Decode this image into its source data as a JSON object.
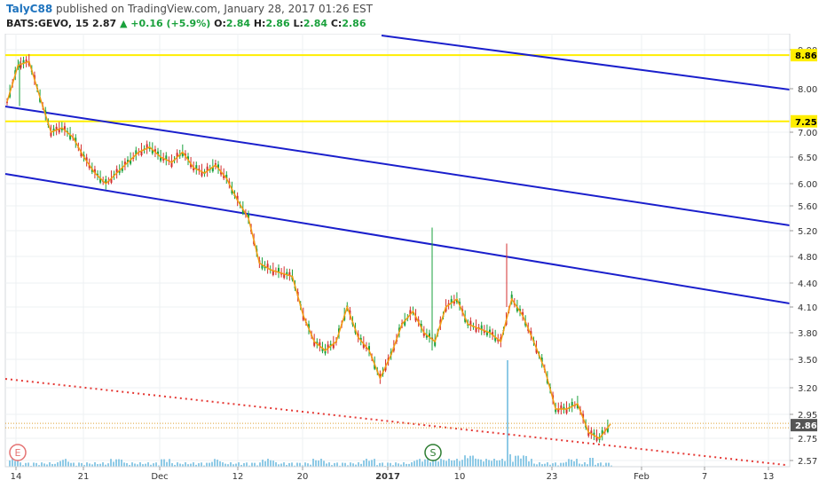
{
  "header": {
    "author": "TalyC88",
    "published": "published on TradingView.com, January 28, 2017 01:26 EST",
    "symbol": "BATS:GEVO, 15",
    "last": "2.87",
    "change": "+0.16 (+5.9%)",
    "o_label": "O:",
    "o_value": "2.84",
    "h_label": "H:",
    "h_value": "2.86",
    "l_label": "L:",
    "l_value": "2.84",
    "c_label": "C:",
    "c_value": "2.86"
  },
  "colors": {
    "up": "#1aa13c",
    "down": "#d32f2f",
    "ma": "#f39c12",
    "channel": "#1a1fcc",
    "horizontal": "#ffee00",
    "support": "#e53935",
    "volume": "#8ecae6",
    "grid": "#eef0f3",
    "axis_text": "#333333"
  },
  "chart_data": {
    "type": "line",
    "title": "",
    "xlabel": "",
    "ylabel": "",
    "ylim": [
      2.45,
      9.2
    ],
    "x_tick_labels": [
      "14",
      "21",
      "Dec",
      "12",
      "20",
      "2017",
      "10",
      "23",
      "Feb",
      "7",
      "13"
    ],
    "y_tick_labels": [
      "9.00",
      "8.00",
      "7.00",
      "6.50",
      "6.00",
      "5.60",
      "5.20",
      "4.80",
      "4.40",
      "4.10",
      "3.80",
      "3.50",
      "3.20",
      "2.95",
      "2.75",
      "2.57"
    ],
    "price_labels": [
      "8.86",
      "7.25",
      "2.86"
    ],
    "series": [
      {
        "values": [
          7.7,
          8.6,
          8.7,
          7.8,
          7.0,
          7.1,
          6.9,
          6.5,
          6.2,
          6.0,
          6.2,
          6.4,
          6.6,
          6.7,
          6.5,
          6.4,
          6.6,
          6.3,
          6.2,
          6.35,
          6.1,
          5.7,
          5.4,
          4.7,
          4.6,
          4.55,
          4.5,
          4.0,
          3.7,
          3.6,
          3.7,
          4.1,
          3.75,
          3.6,
          3.3,
          3.55,
          3.9,
          4.05,
          3.8,
          3.7,
          4.1,
          4.2,
          3.9,
          3.85,
          3.8,
          3.7,
          4.2,
          4.0,
          3.7,
          3.4,
          3.0,
          3.0,
          3.05,
          2.8,
          2.75,
          2.87
        ]
      }
    ],
    "annotations": {
      "horizontal_levels": [
        8.86,
        7.25
      ],
      "current_price": 2.86,
      "event_markers": [
        "E",
        "S"
      ]
    }
  }
}
